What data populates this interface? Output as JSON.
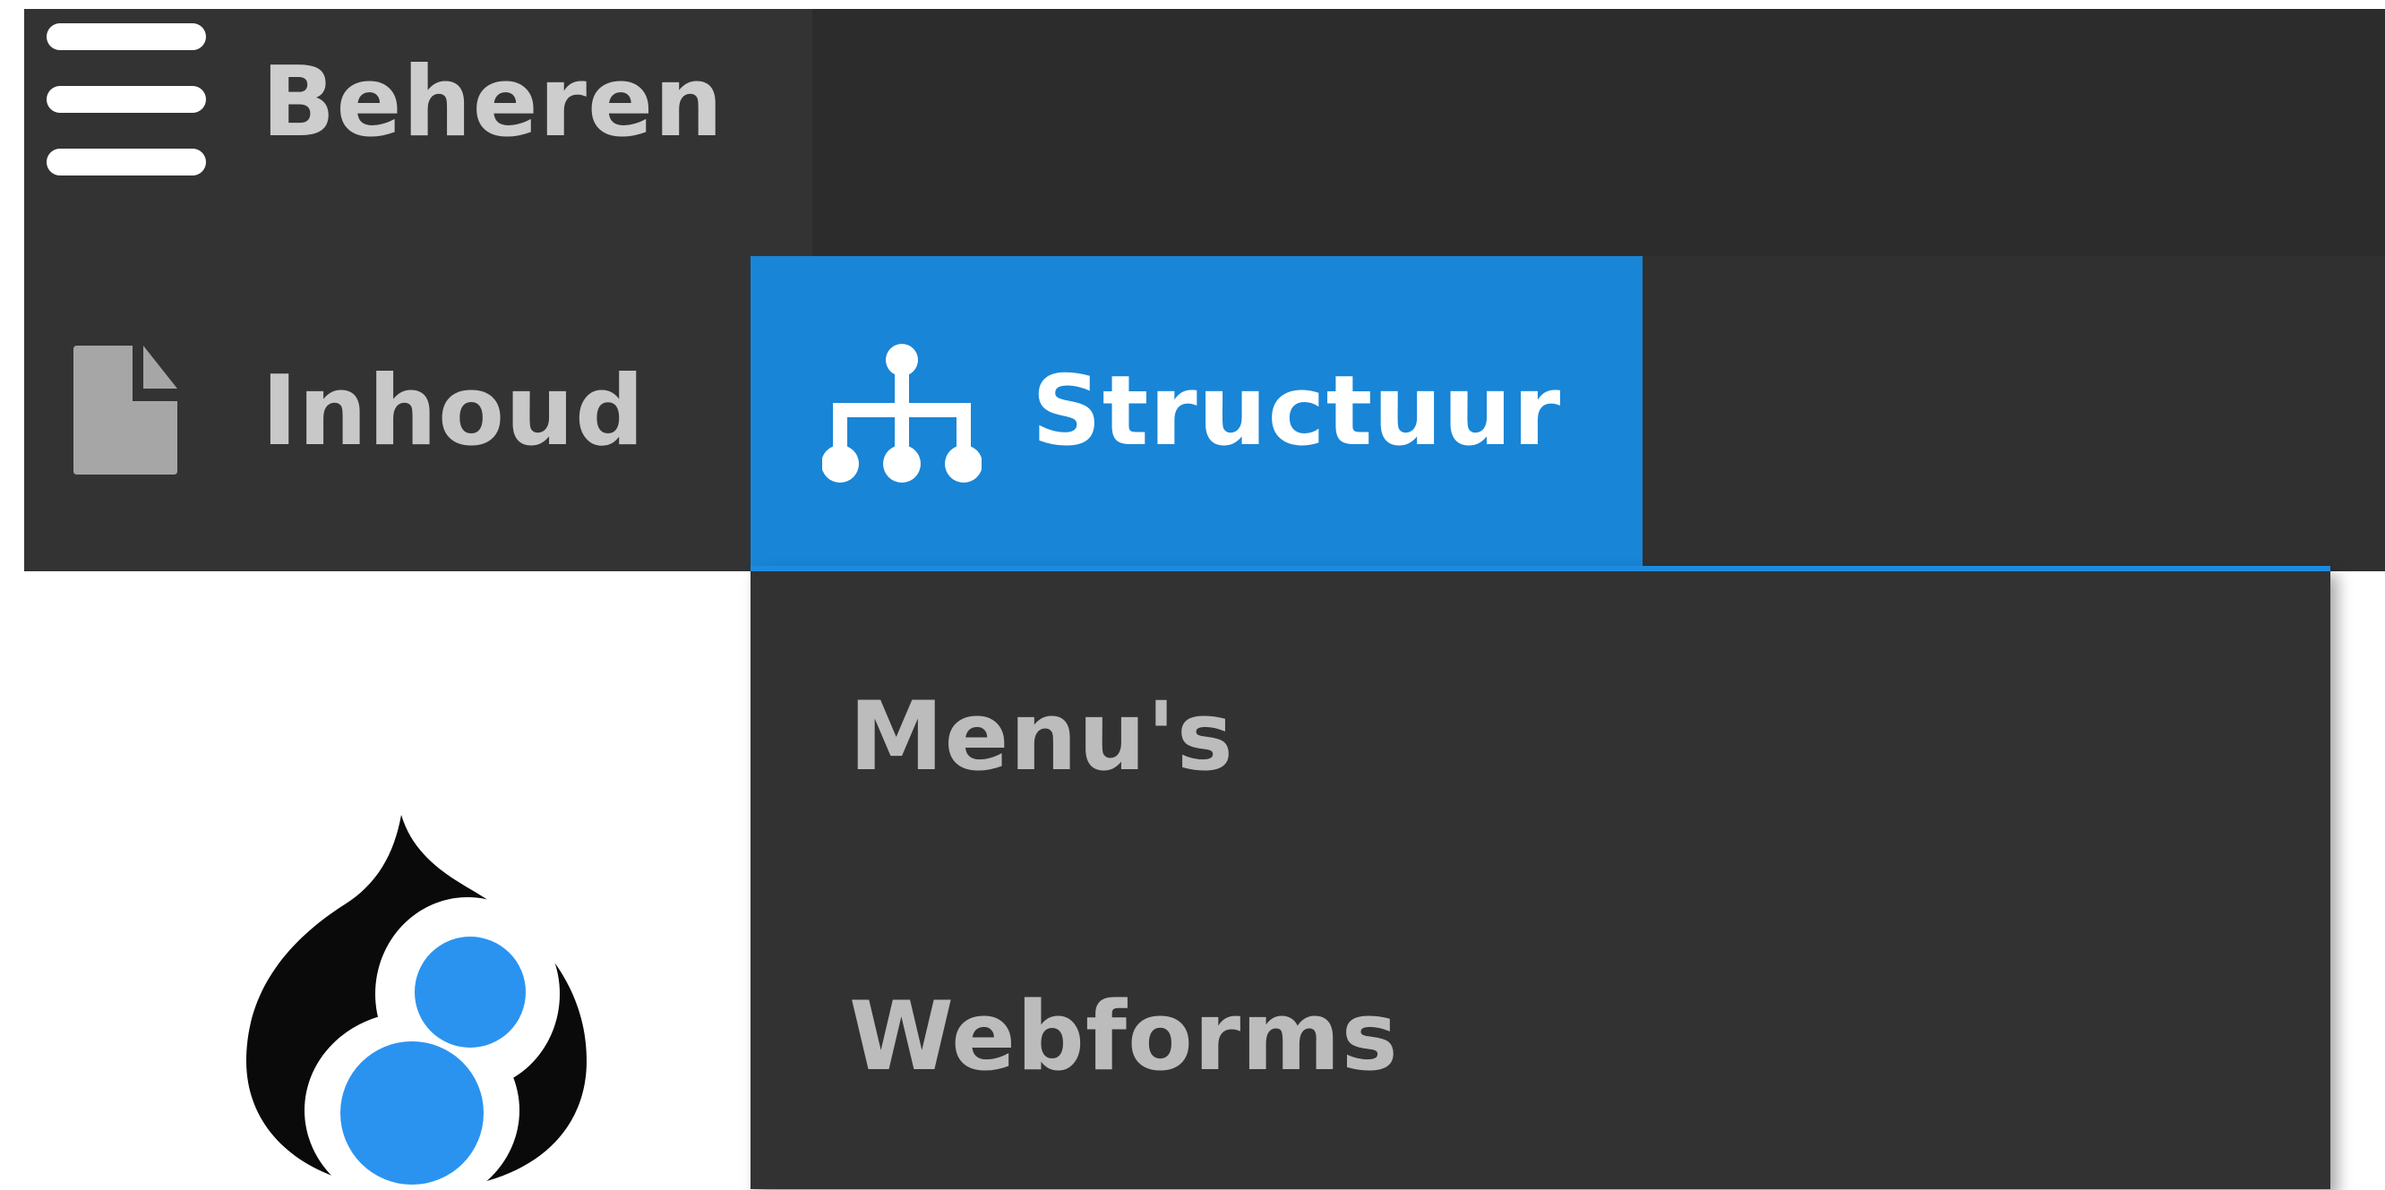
{
  "toolbar": {
    "manage_label": "Beheren",
    "menu_icon": "hamburger-menu-icon"
  },
  "tray": {
    "items": [
      {
        "label": "Inhoud",
        "icon": "document-icon",
        "active": false
      },
      {
        "label": "Structuur",
        "icon": "sitemap-icon",
        "active": true
      }
    ]
  },
  "submenu": {
    "items": [
      {
        "label": "Menu's"
      },
      {
        "label": "Webforms"
      }
    ]
  },
  "logo": {
    "icon": "drupal-8-logo"
  },
  "colors": {
    "toolbar_bg": "#2f2f2f",
    "tray_bg": "#333333",
    "active_tab": "#1985d6",
    "dropdown_bg": "#323232",
    "text": "#cdcdcd",
    "logo_accent": "#2a93f0"
  }
}
